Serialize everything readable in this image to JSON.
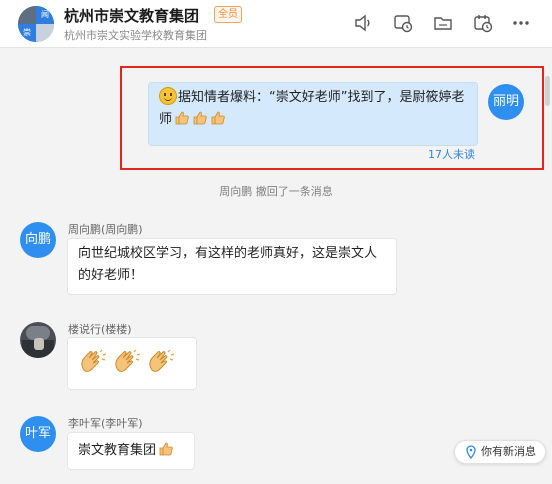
{
  "header": {
    "group_name": "杭州市崇文教育集团",
    "badge": "全员",
    "org": "杭州市崇文实验学校教育集团",
    "avatar_text_a": "闻",
    "avatar_text_b": "崇"
  },
  "icons": [
    "speaker-icon",
    "history-icon",
    "folder-icon",
    "calendar-icon",
    "more-icon"
  ],
  "messages": {
    "mine": {
      "avatar": "丽明",
      "text": "据知情者爆料：“崇文好老师”找到了，是尉筱婷老师",
      "unread": "17人未读"
    },
    "recall": "周向鹏 撤回了一条消息",
    "m1": {
      "avatar": "向鹏",
      "sender": "周向鹏(周向鹏)",
      "text": "向世纪城校区学习，有这样的老师真好，这是崇文人的好老师！"
    },
    "m2": {
      "sender": "楼说行(楼楼)"
    },
    "m3": {
      "avatar": "叶军",
      "sender": "李叶军(李叶军)",
      "text": "崇文教育集团"
    }
  },
  "new_message_pill": "你有新消息",
  "colors": {
    "accent": "#2f8ff0",
    "highlight": "#e8231a",
    "my_bubble": "#d5e9fd",
    "badge": "#ee8a2c"
  }
}
